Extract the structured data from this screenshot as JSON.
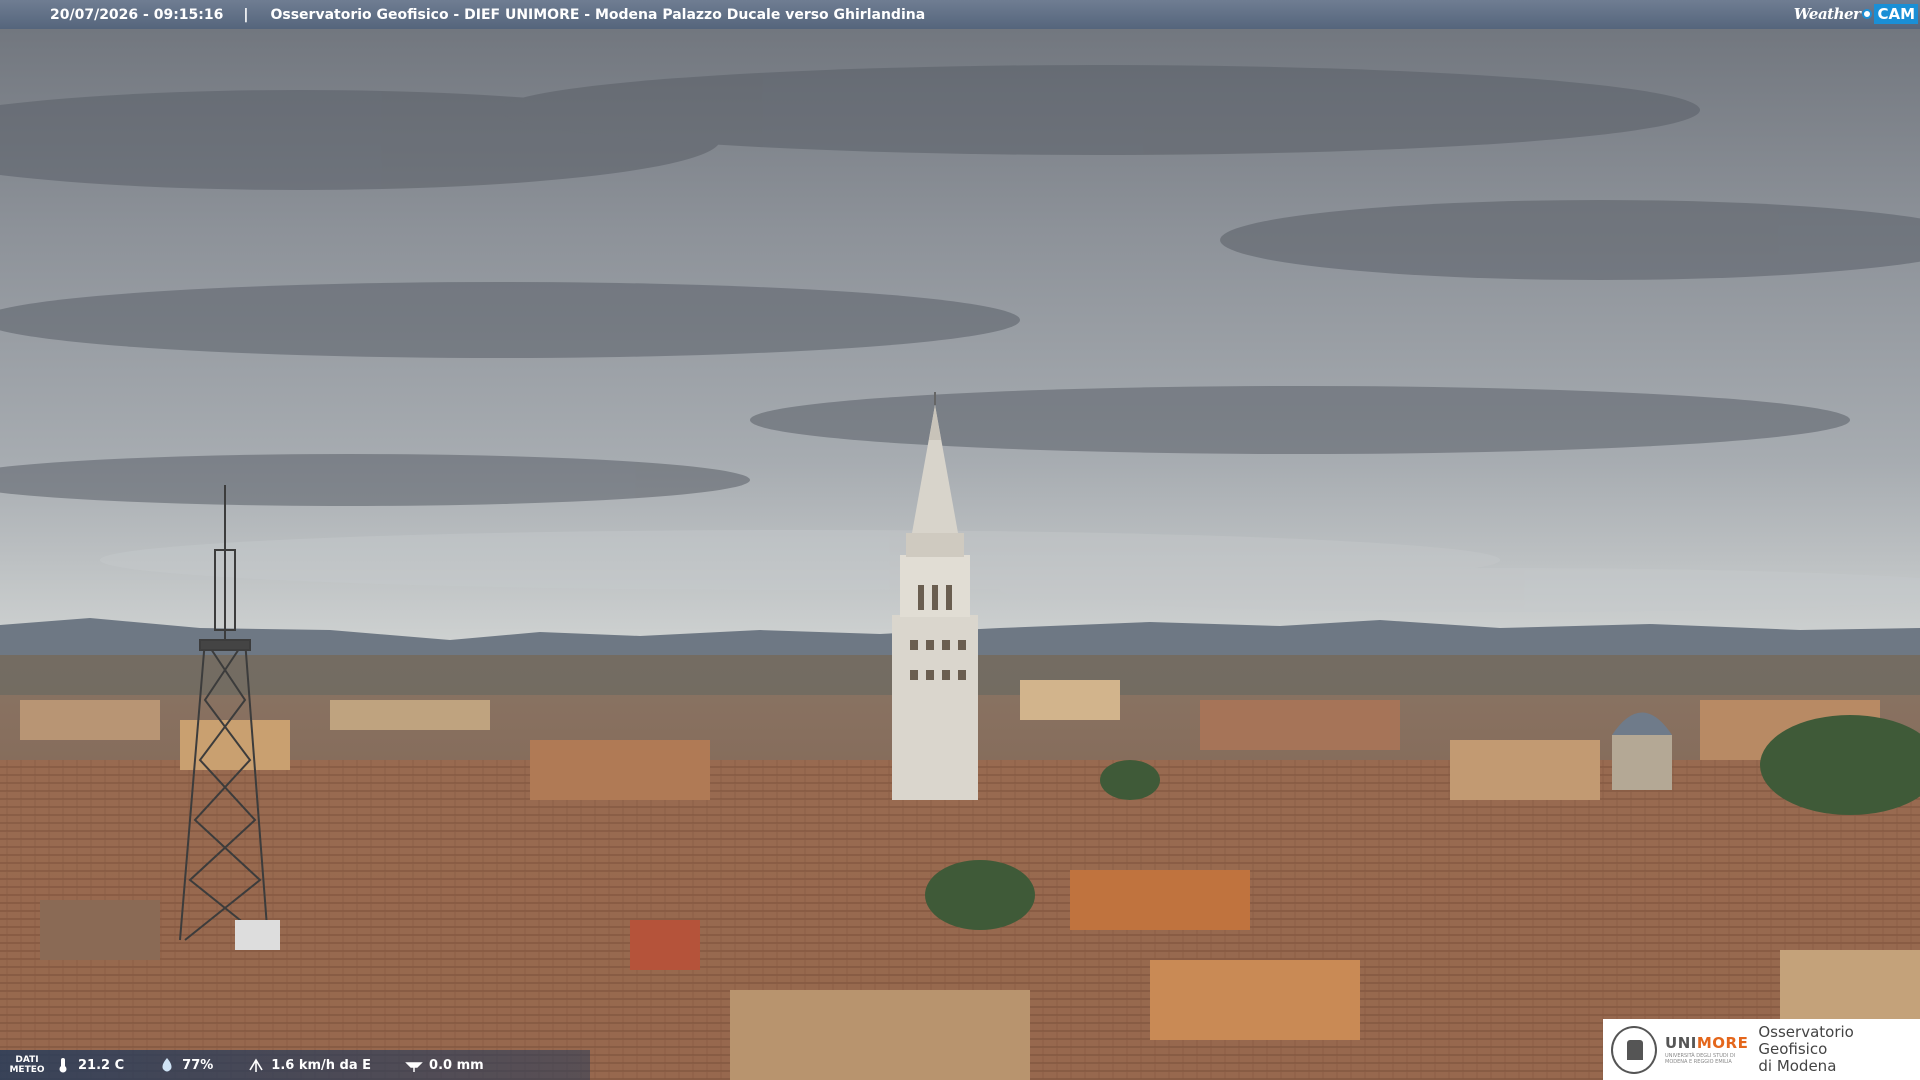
{
  "header": {
    "timestamp": "20/07/2026 - 09:15:16",
    "separator": "|",
    "title": "Osservatorio Geofisico - DIEF UNIMORE - Modena Palazzo Ducale verso Ghirlandina"
  },
  "brand": {
    "weather": "Weather",
    "cam": "CAM",
    "accent_color": "#1a8fd6"
  },
  "meteo": {
    "label_line1": "DATI",
    "label_line2": "METEO",
    "temperature": "21.2 C",
    "humidity": "77%",
    "wind": "1.6 km/h da E",
    "rain": "0.0 mm"
  },
  "footer_logo": {
    "university": "UNIMORE",
    "university_sub": "UNIVERSITÀ DEGLI STUDI DI MODENA E REGGIO EMILIA",
    "observatory_line1": "Osservatorio Geofisico",
    "observatory_line2": "di Modena",
    "accent_color": "#e4661b"
  },
  "icons": [
    "thermometer-icon",
    "humidity-drop-icon",
    "wind-icon",
    "rain-gauge-icon"
  ]
}
